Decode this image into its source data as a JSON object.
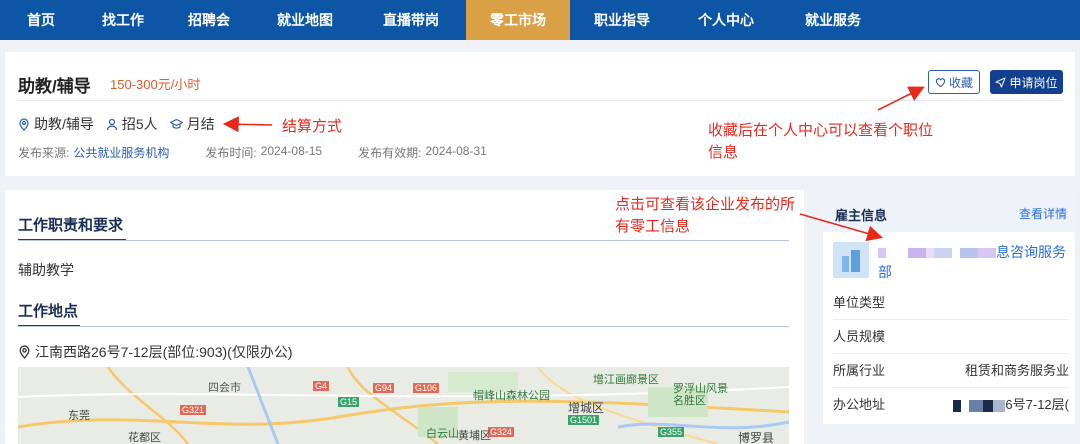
{
  "nav": {
    "items": [
      {
        "label": "首页"
      },
      {
        "label": "找工作"
      },
      {
        "label": "招聘会"
      },
      {
        "label": "就业地图"
      },
      {
        "label": "直播带岗"
      },
      {
        "label": "零工市场",
        "active": true
      },
      {
        "label": "职业指导"
      },
      {
        "label": "个人中心"
      },
      {
        "label": "就业服务"
      }
    ]
  },
  "job": {
    "title": "助教/辅导",
    "salary": "150-300元/小时",
    "tags": {
      "category": "助教/辅导",
      "headcount": "招5人",
      "settlement": "月结"
    },
    "source_label": "发布来源:",
    "source_value": "公共就业服务机构",
    "publish_label": "发布时间:",
    "publish_value": "2024-08-15",
    "valid_label": "发布有效期:",
    "valid_value": "2024-08-31"
  },
  "actions": {
    "favorite_label": "收藏",
    "apply_label": "申请岗位"
  },
  "annotations": {
    "settlement": "结算方式",
    "favorite": "收藏后在个人中心可以查看个职位信息",
    "employer": "点击可查看该企业发布的所有零工信息"
  },
  "duties": {
    "title": "工作职责和要求",
    "text": "辅助教学"
  },
  "location": {
    "title": "工作地点",
    "address": "江南西路26号7-12层(部位:903)(仅限办公)",
    "map_labels": [
      "四会市",
      "G321",
      "G15",
      "G324",
      "G94",
      "G106",
      "G4",
      "G355",
      "G1501",
      "帽峰山森林公园",
      "增江画廊景区",
      "罗浮山风景名胜区",
      "白云山",
      "黄埔区",
      "增城区",
      "博罗县",
      "花都区",
      "东莞"
    ]
  },
  "employer": {
    "title": "雇主信息",
    "details_link": "查看详情",
    "name": "息咨询服务部",
    "rows": [
      {
        "label": "单位类型",
        "value": ""
      },
      {
        "label": "人员规模",
        "value": ""
      },
      {
        "label": "所属行业",
        "value": "租赁和商务服务业"
      },
      {
        "label": "办公地址",
        "value": "6号7-12层("
      }
    ]
  },
  "colors": {
    "nav_bg": "#0d56a6",
    "nav_active": "#d9a046",
    "accent_red": "#e8291c",
    "salary": "#e05a2b",
    "link": "#2c6fd6"
  }
}
